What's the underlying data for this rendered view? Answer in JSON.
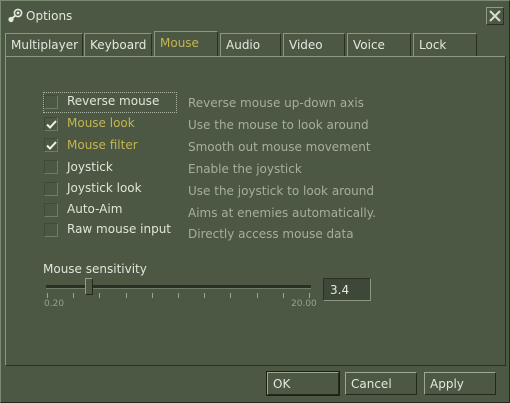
{
  "window": {
    "title": "Options",
    "close_icon": "close-x-icon",
    "app_icon": "steam-icon"
  },
  "tabs": [
    {
      "label": "Multiplayer",
      "active": false
    },
    {
      "label": "Keyboard",
      "active": false
    },
    {
      "label": "Mouse",
      "active": true
    },
    {
      "label": "Audio",
      "active": false
    },
    {
      "label": "Video",
      "active": false
    },
    {
      "label": "Voice",
      "active": false
    },
    {
      "label": "Lock",
      "active": false
    }
  ],
  "options": [
    {
      "label": "Reverse mouse",
      "checked": false,
      "description": "Reverse mouse up-down axis"
    },
    {
      "label": "Mouse look",
      "checked": true,
      "description": "Use the mouse to look around"
    },
    {
      "label": "Mouse filter",
      "checked": true,
      "description": "Smooth out mouse movement"
    },
    {
      "label": "Joystick",
      "checked": false,
      "description": "Enable the joystick"
    },
    {
      "label": "Joystick look",
      "checked": false,
      "description": "Use the joystick to look around"
    },
    {
      "label": "Auto-Aim",
      "checked": false,
      "description": "Aims at enemies automatically."
    },
    {
      "label": "Raw mouse input",
      "checked": false,
      "description": "Directly access mouse data"
    }
  ],
  "sensitivity": {
    "label": "Mouse sensitivity",
    "min_label": "0.20",
    "max_label": "20.00",
    "min": 0.2,
    "max": 20.0,
    "value": 3.4,
    "value_text": "3.4"
  },
  "buttons": {
    "ok": "OK",
    "cancel": "Cancel",
    "apply": "Apply"
  },
  "colors": {
    "background": "#4c5844",
    "highlight_text": "#c4b550",
    "description_text": "#a6ae9c"
  }
}
